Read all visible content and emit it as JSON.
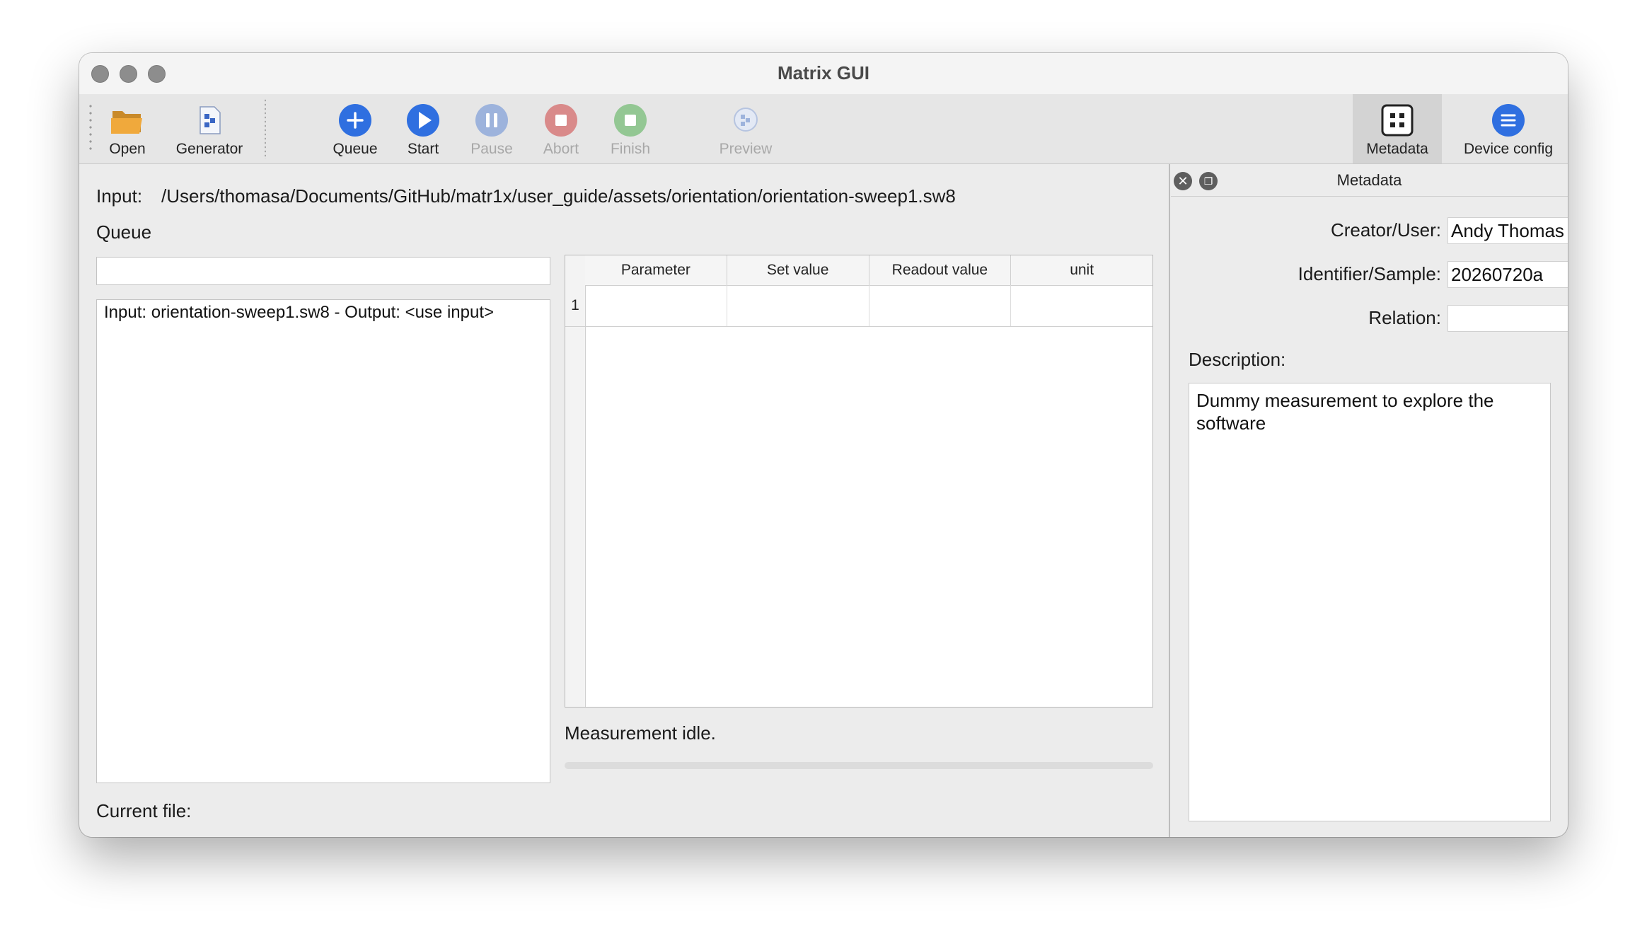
{
  "window": {
    "title": "Matrix GUI"
  },
  "toolbar": {
    "open": "Open",
    "generator": "Generator",
    "queue": "Queue",
    "start": "Start",
    "pause": "Pause",
    "abort": "Abort",
    "finish": "Finish",
    "preview": "Preview",
    "metadata": "Metadata",
    "device_config": "Device config"
  },
  "main": {
    "input_label": "Input:",
    "input_path": "/Users/thomasa/Documents/GitHub/matr1x/user_guide/assets/orientation/orientation-sweep1.sw8",
    "queue_label": "Queue",
    "queue_filter_value": "",
    "queue_items": [
      "Input: orientation-sweep1.sw8 - Output: <use input>"
    ],
    "current_file_label": "Current file:",
    "current_file_value": ""
  },
  "params_table": {
    "columns": [
      "Parameter",
      "Set value",
      "Readout value",
      "unit"
    ],
    "rows": [
      {
        "index": "1",
        "cells": [
          "",
          "",
          "",
          ""
        ]
      }
    ]
  },
  "status": {
    "text": "Measurement idle.",
    "progress": 0
  },
  "metadata_panel": {
    "title": "Metadata",
    "creator_label": "Creator/User:",
    "creator_value": "Andy Thomas",
    "identifier_label": "Identifier/Sample:",
    "identifier_value": "20260720a",
    "relation_label": "Relation:",
    "relation_value": "",
    "description_label": "Description:",
    "description_value": "Dummy measurement to explore the software"
  },
  "colors": {
    "accent_blue": "#2f6fe0",
    "disabled_blue": "#9db3dc",
    "disabled_red": "#d98a8a",
    "disabled_green": "#93c793"
  }
}
